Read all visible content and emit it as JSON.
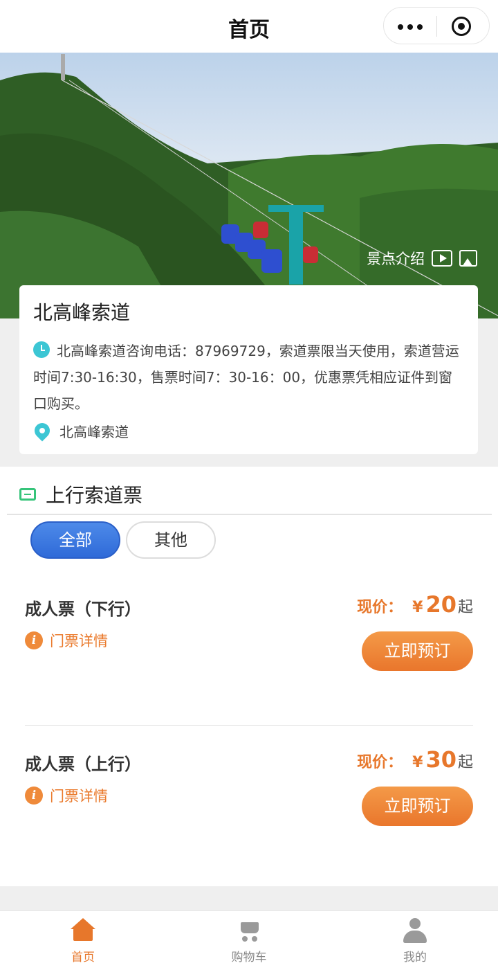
{
  "nav": {
    "title": "首页"
  },
  "hero": {
    "intro_label": "景点介绍"
  },
  "info": {
    "title": "北高峰索道",
    "description": "北高峰索道咨询电话：87969729，索道票限当天使用，索道营运时间7:30-16:30，售票时间7：30-16：00，优惠票凭相应证件到窗口购买。",
    "location": "北高峰索道"
  },
  "section": {
    "title": "上行索道票"
  },
  "filters": [
    {
      "label": "全部",
      "active": true
    },
    {
      "label": "其他",
      "active": false
    }
  ],
  "tickets": [
    {
      "name": "成人票（下行）",
      "detail_label": "门票详情",
      "price_label": "现价：",
      "currency": "¥",
      "price": "20",
      "price_suffix": "起",
      "button_label": "立即预订"
    },
    {
      "name": "成人票（上行）",
      "detail_label": "门票详情",
      "price_label": "现价：",
      "currency": "¥",
      "price": "30",
      "price_suffix": "起",
      "button_label": "立即预订"
    }
  ],
  "tabbar": [
    {
      "label": "首页",
      "icon": "home-icon",
      "active": true
    },
    {
      "label": "购物车",
      "icon": "cart-icon",
      "active": false
    },
    {
      "label": "我的",
      "icon": "user-icon",
      "active": false
    }
  ],
  "colors": {
    "accent": "#e7772b",
    "active_filter": "#3a74de",
    "info_icon": "#3cc6d4",
    "ticket_icon": "#36c47a"
  }
}
